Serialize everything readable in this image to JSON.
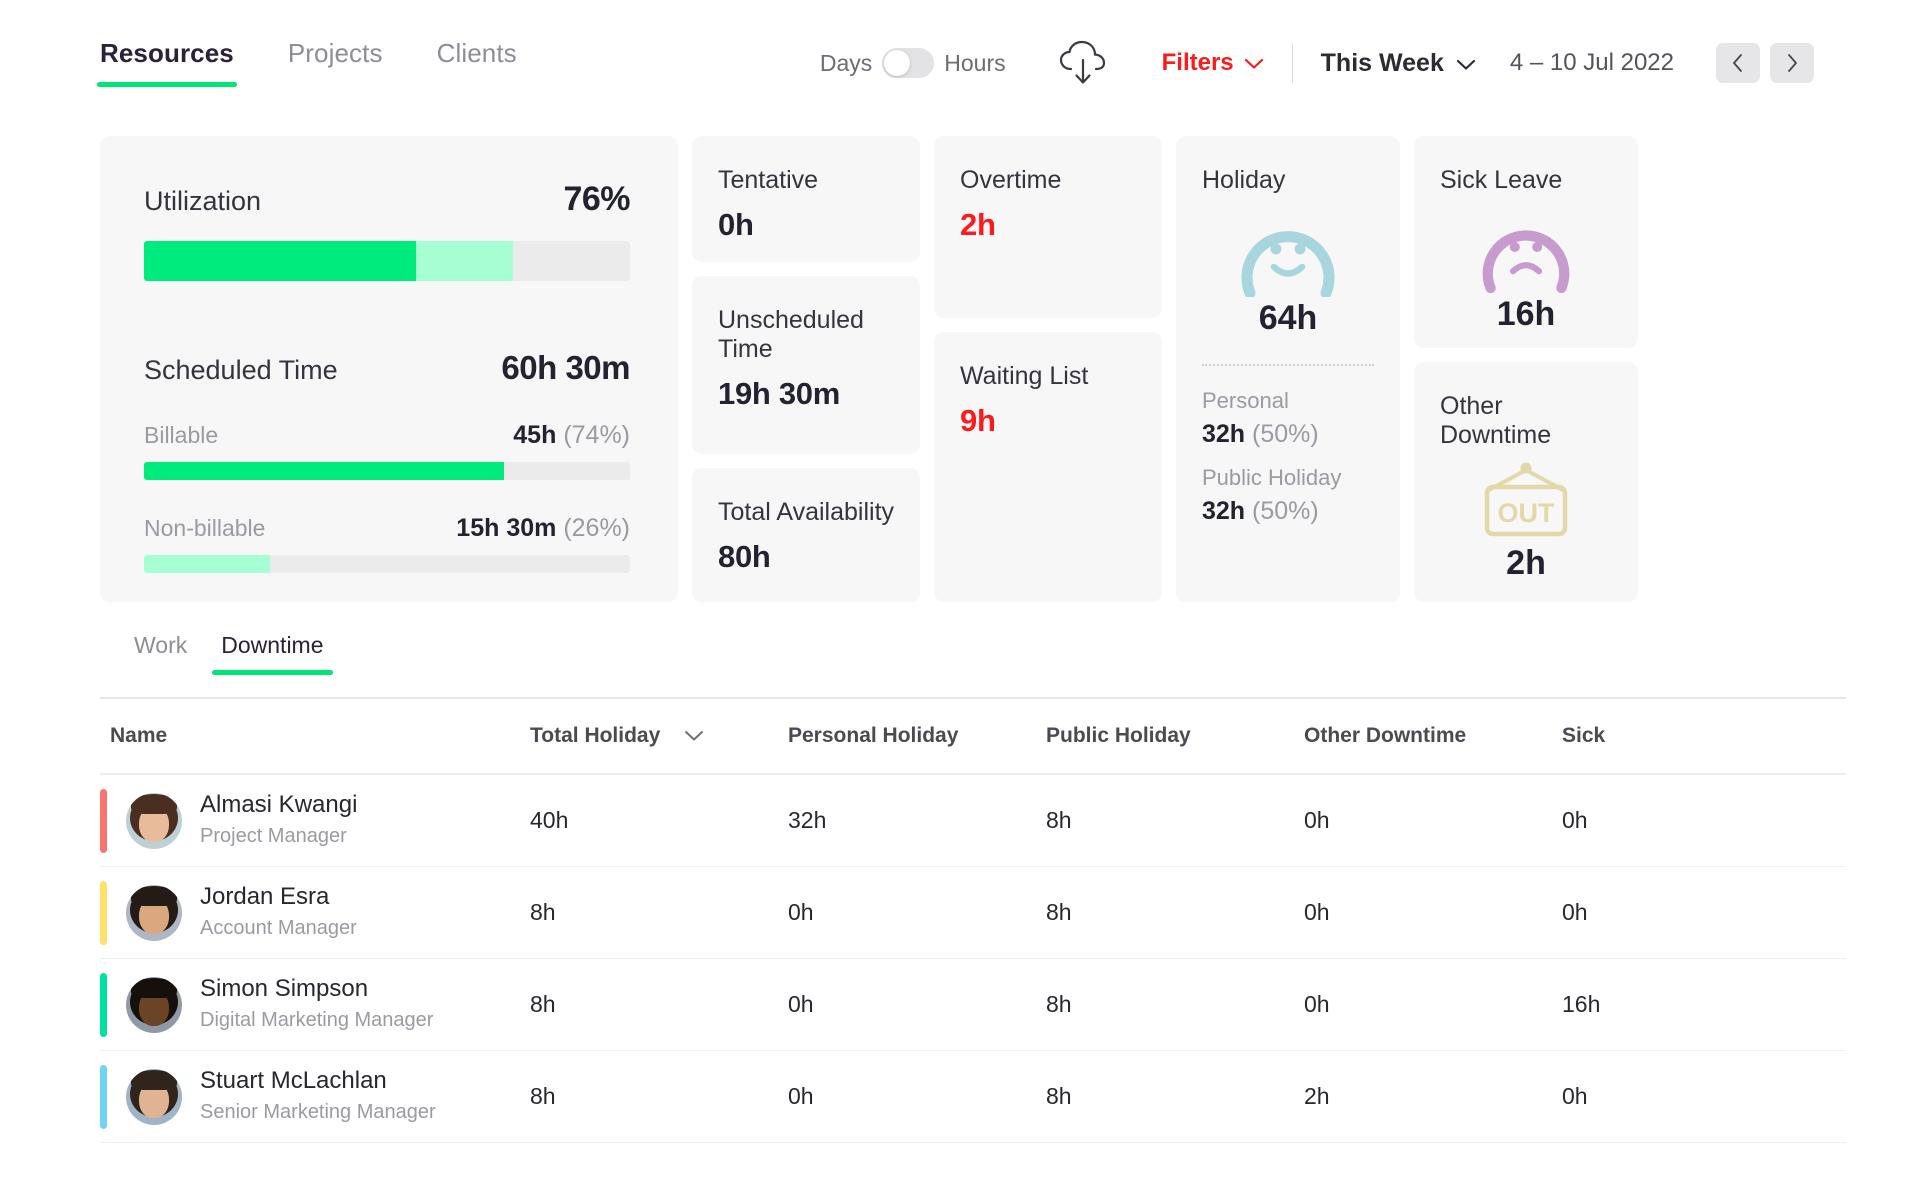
{
  "header": {
    "tabs": [
      {
        "label": "Resources",
        "active": true
      },
      {
        "label": "Projects",
        "active": false
      },
      {
        "label": "Clients",
        "active": false
      }
    ],
    "unit_toggle": {
      "left_label": "Days",
      "right_label": "Hours",
      "selected": "Days"
    },
    "download_icon": "cloud-download-icon",
    "filters_label": "Filters",
    "filters_chevron": "chevron-down-icon",
    "period_label": "This Week",
    "period_chevron": "chevron-down-icon",
    "date_range": "4 – 10 Jul 2022",
    "prev_icon": "chevron-left-icon",
    "next_icon": "chevron-right-icon",
    "accent_green": "#00e676",
    "accent_red": "#ff1a1a"
  },
  "cards": {
    "utilization": {
      "title": "Utilization",
      "value": "76%",
      "bar": {
        "strong_pct": 56,
        "light_pct": 20
      }
    },
    "scheduled": {
      "title": "Scheduled Time",
      "value": "60h 30m",
      "billable": {
        "label": "Billable",
        "value": "45h",
        "pct": "(74%)",
        "fill": 74
      },
      "non_billable": {
        "label": "Non-billable",
        "value": "15h 30m",
        "pct": "(26%)",
        "fill": 26
      }
    },
    "tentative": {
      "title": "Tentative",
      "value": "0h"
    },
    "unscheduled": {
      "title": "Unscheduled Time",
      "value": "19h 30m"
    },
    "availability": {
      "title": "Total Availability",
      "value": "80h"
    },
    "overtime": {
      "title": "Overtime",
      "value": "2h",
      "value_color": "#ff1a1a"
    },
    "waiting": {
      "title": "Waiting List",
      "value": "9h",
      "value_color": "#ff1a1a"
    },
    "holiday": {
      "title": "Holiday",
      "icon": "smiley-face-icon",
      "icon_color": "#a9d6de",
      "value": "64h",
      "personal": {
        "label": "Personal",
        "value": "32h",
        "pct": "(50%)"
      },
      "public": {
        "label": "Public Holiday",
        "value": "32h",
        "pct": "(50%)"
      }
    },
    "sick_leave": {
      "title": "Sick Leave",
      "icon": "sad-face-icon",
      "icon_color": "#c79bce",
      "value": "16h"
    },
    "other_downtime": {
      "title": "Other Downtime",
      "icon": "out-sign-icon",
      "icon_color": "#e3d9a8",
      "icon_text": "OUT",
      "value": "2h"
    }
  },
  "subtabs": [
    {
      "label": "Work",
      "active": false
    },
    {
      "label": "Downtime",
      "active": true
    }
  ],
  "table": {
    "columns": [
      {
        "label": "Name",
        "sort": false
      },
      {
        "label": "Total Holiday",
        "sort": true,
        "sort_icon": "chevron-down-icon"
      },
      {
        "label": "Personal Holiday",
        "sort": false
      },
      {
        "label": "Public Holiday",
        "sort": false
      },
      {
        "label": "Other Downtime",
        "sort": false
      },
      {
        "label": "Sick",
        "sort": false
      }
    ],
    "rows": [
      {
        "name": "Almasi Kwangi",
        "role": "Project Manager",
        "accent": "#f8736f",
        "avatar": "woman-curly-hair-avatar",
        "total_holiday": "40h",
        "personal_holiday": "32h",
        "public_holiday": "8h",
        "other_downtime": "0h",
        "sick": "0h"
      },
      {
        "name": "Jordan Esra",
        "role": "Account Manager",
        "accent": "#ffe06b",
        "avatar": "man-dark-hair-avatar",
        "total_holiday": "8h",
        "personal_holiday": "0h",
        "public_holiday": "8h",
        "other_downtime": "0h",
        "sick": "0h"
      },
      {
        "name": "Simon Simpson",
        "role": "Digital Marketing Manager",
        "accent": "#00e0a0",
        "avatar": "man-smiling-avatar",
        "total_holiday": "8h",
        "personal_holiday": "0h",
        "public_holiday": "8h",
        "other_downtime": "0h",
        "sick": "16h"
      },
      {
        "name": "Stuart McLachlan",
        "role": "Senior Marketing Manager",
        "accent": "#6fd4f5",
        "avatar": "man-beard-avatar",
        "total_holiday": "8h",
        "personal_holiday": "0h",
        "public_holiday": "8h",
        "other_downtime": "2h",
        "sick": "0h"
      }
    ]
  }
}
